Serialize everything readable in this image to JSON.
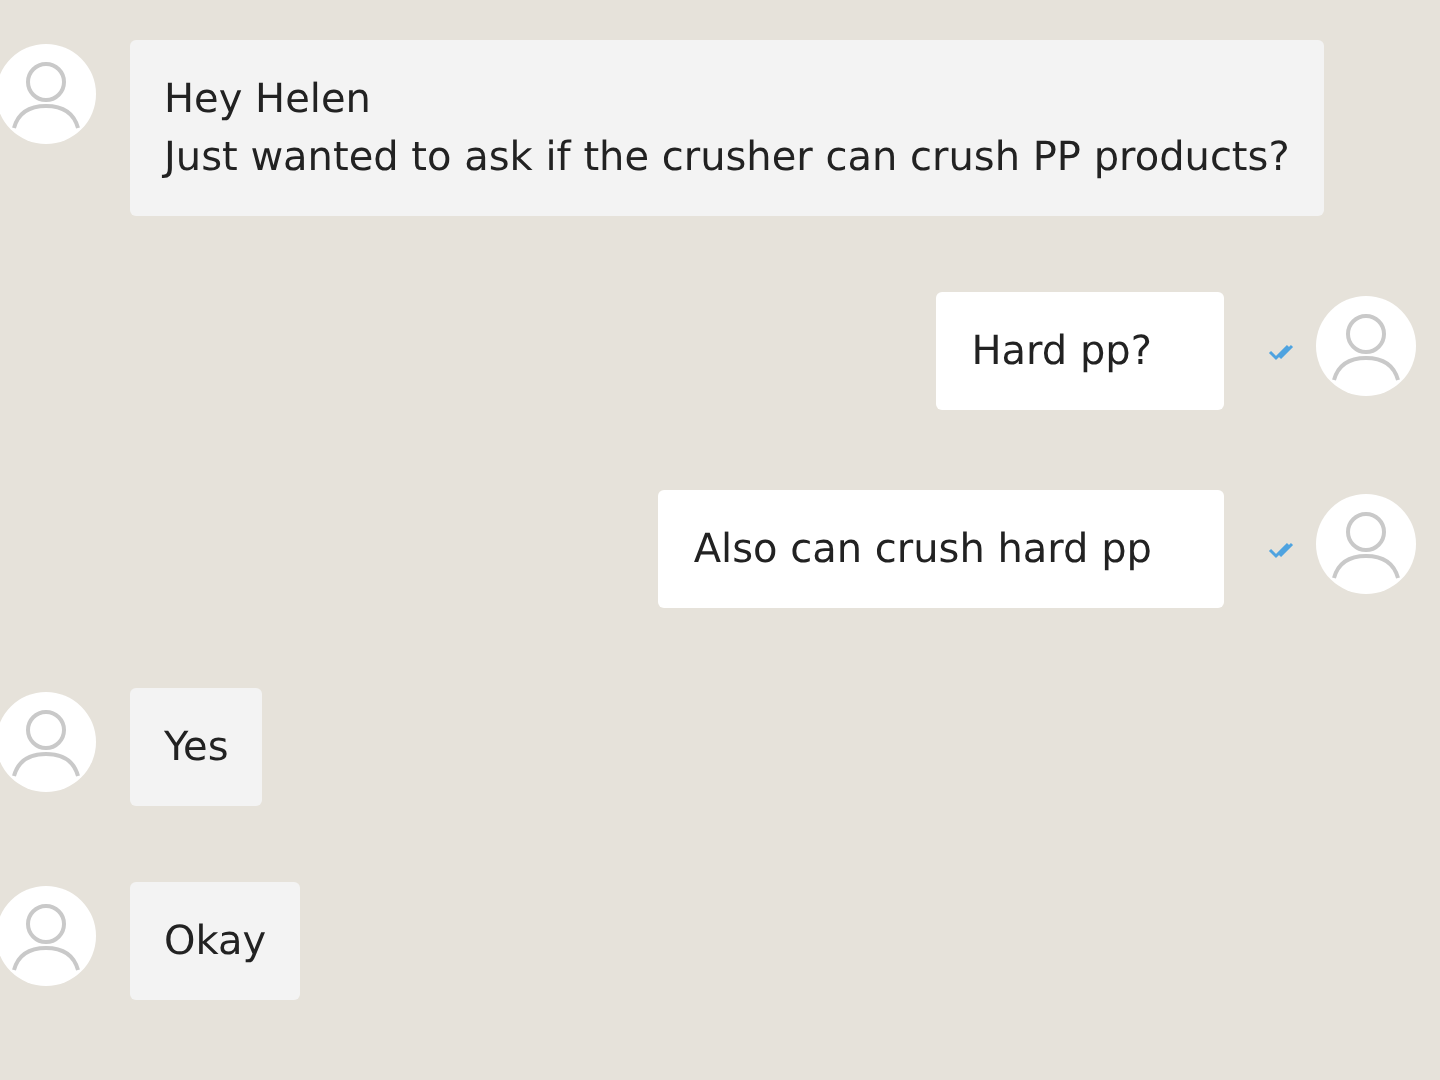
{
  "messages": [
    {
      "outgoing": false,
      "lines": [
        "Hey Helen",
        "Just wanted to ask if the crusher can crush PP products?"
      ]
    },
    {
      "outgoing": true,
      "lines": [
        "Hard pp?"
      ],
      "read": true
    },
    {
      "outgoing": true,
      "lines": [
        "Also can crush hard pp"
      ],
      "read": true
    },
    {
      "outgoing": false,
      "lines": [
        "Yes"
      ]
    },
    {
      "outgoing": false,
      "lines": [
        "Okay"
      ]
    }
  ]
}
